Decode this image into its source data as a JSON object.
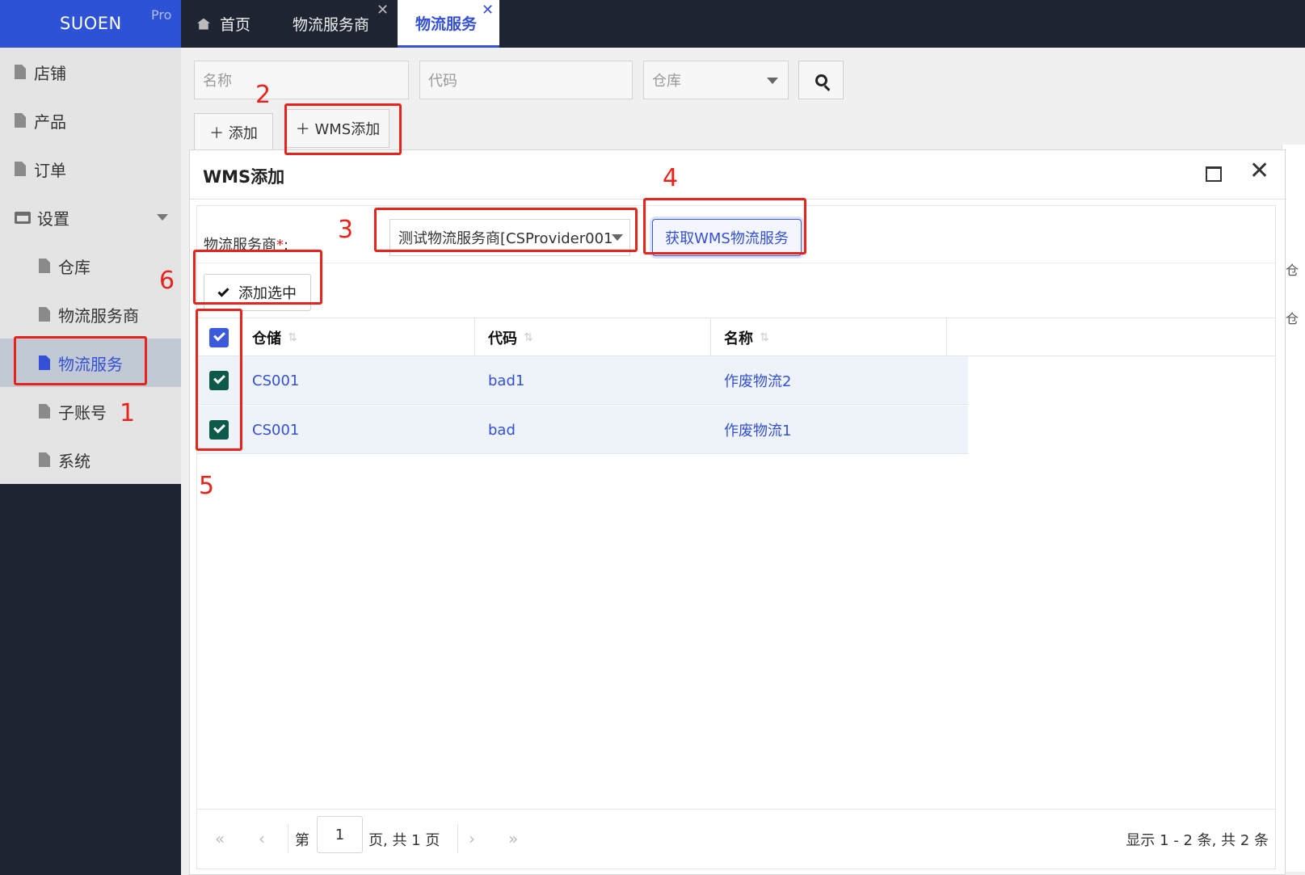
{
  "brand": {
    "name": "SUOEN",
    "badge": "Pro"
  },
  "sidebar": {
    "items": [
      {
        "label": "店铺"
      },
      {
        "label": "产品"
      },
      {
        "label": "订单"
      },
      {
        "label": "设置"
      },
      {
        "label": "仓库"
      },
      {
        "label": "物流服务商"
      },
      {
        "label": "物流服务"
      },
      {
        "label": "子账号"
      },
      {
        "label": "系统"
      }
    ],
    "active": "物流服务"
  },
  "tabs": [
    {
      "label": "首页"
    },
    {
      "label": "物流服务商",
      "close": "✕"
    },
    {
      "label": "物流服务",
      "close": "✕"
    }
  ],
  "filters": {
    "name_placeholder": "名称",
    "code_placeholder": "代码",
    "warehouse_placeholder": "仓库"
  },
  "toolbar": {
    "add_label": "＋ 添加",
    "wms_add_label": "＋ WMS添加"
  },
  "dialog": {
    "title": "WMS添加",
    "close": "✕",
    "form": {
      "provider_label": "物流服务商",
      "required_mark": "*",
      "colon": ":",
      "provider_value": "测试物流服务商[CSProvider001",
      "fetch_button": "获取WMS物流服务"
    },
    "add_selected": "添加选中",
    "table": {
      "columns": [
        "仓储",
        "代码",
        "名称"
      ],
      "sort_icon": "⇅",
      "rows": [
        {
          "warehouse": "CS001",
          "code": "bad1",
          "name": "作废物流2",
          "checked": true
        },
        {
          "warehouse": "CS001",
          "code": "bad",
          "name": "作废物流1",
          "checked": true
        }
      ]
    },
    "pager": {
      "first": "«",
      "prev": "‹",
      "next": "›",
      "last": "»",
      "page_prefix": "第",
      "page": "1",
      "page_suffix": "页, 共 1 页",
      "info": "显示 1 - 2 条, 共 2 条"
    }
  },
  "side_icon": "仓",
  "annotations": [
    "1",
    "2",
    "3",
    "4",
    "5",
    "6"
  ],
  "colors": {
    "brand": "#2d52d6",
    "accent": "#3450d4",
    "annotation": "#e8231c",
    "sidebar_dark": "#1f2432"
  }
}
